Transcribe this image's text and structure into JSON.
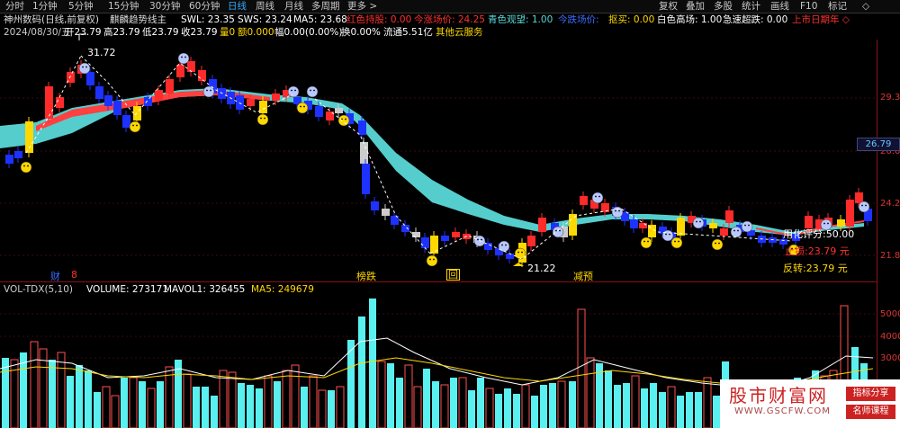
{
  "toolbar": {
    "periods": [
      "分时",
      "1分钟",
      "5分钟",
      "15分钟",
      "30分钟",
      "60分钟",
      "日线",
      "周线",
      "月线",
      "多周期",
      "更多 >"
    ],
    "active_period": "日线",
    "right_buttons": [
      "复权",
      "叠加",
      "多股",
      "统计",
      "画线",
      "F10",
      "标记",
      "◇"
    ]
  },
  "info_line1": {
    "stock": "神州数码(日线,前复权)",
    "indicator": "麒麟趋势线主",
    "swl": "SWL: 23.35",
    "sws": "SWS: 23.24",
    "ma5": "MA5: 23.68",
    "red_hold": "红色持股: 0.00",
    "tomorrow_price": "今涨场价: 24.25",
    "cyan_watch": "青色观望: 1.00",
    "today_price": "今跌场价:",
    "buy": "抠买: 0.00",
    "white_high": "白色高场: 1.00",
    "fast_drop": "急速超跌: 0.00",
    "listing": "上市日期年 ◇"
  },
  "info_line2": {
    "date": "2024/08/30/五",
    "open": "开23.79",
    "high": "高23.79",
    "low": "低23.79",
    "close": "收23.79",
    "vol": "量0",
    "amount": "额0.000",
    "amp": "幅0.00(0.00%)",
    "turnover": "换0.00%",
    "float": "流通5.51亿",
    "service": "其他云服务"
  },
  "volume_header": {
    "name": "VOL-TDX(5,10)",
    "volume": "VOLUME: 273171",
    "mavol1": "MAVOL1: 326455",
    "ma5": "MA5: 249679"
  },
  "price_axis": [
    "29.3",
    "26.6",
    "24.2",
    "21.8"
  ],
  "current_price_tag": "26.79",
  "volume_axis": [
    "5000",
    "4000",
    "3000"
  ],
  "annotations": {
    "high_label": "31.72",
    "low_label": "21.22",
    "use_score": "用化评分:50.00",
    "stop": "止损:23.79 元",
    "reverse": "反转:23.79 元",
    "tag_cai": "财",
    "tag_n": "8",
    "tag_bang": "榜跌",
    "tag_hui": "回",
    "tag_jian": "减预"
  },
  "colors": {
    "up": "#ff2a2a",
    "down": "#1e32ff",
    "cyan_band": "#5ad8d8",
    "red_band": "#ff4040",
    "yellow": "#ffd800",
    "volume_up": "#ff5050",
    "volume_down": "#5af0f0"
  },
  "watermark": {
    "title": "股市财富网",
    "url": "WWW.GSCFW.COM",
    "badge1": "指标分享",
    "badge2": "名师课程"
  }
}
